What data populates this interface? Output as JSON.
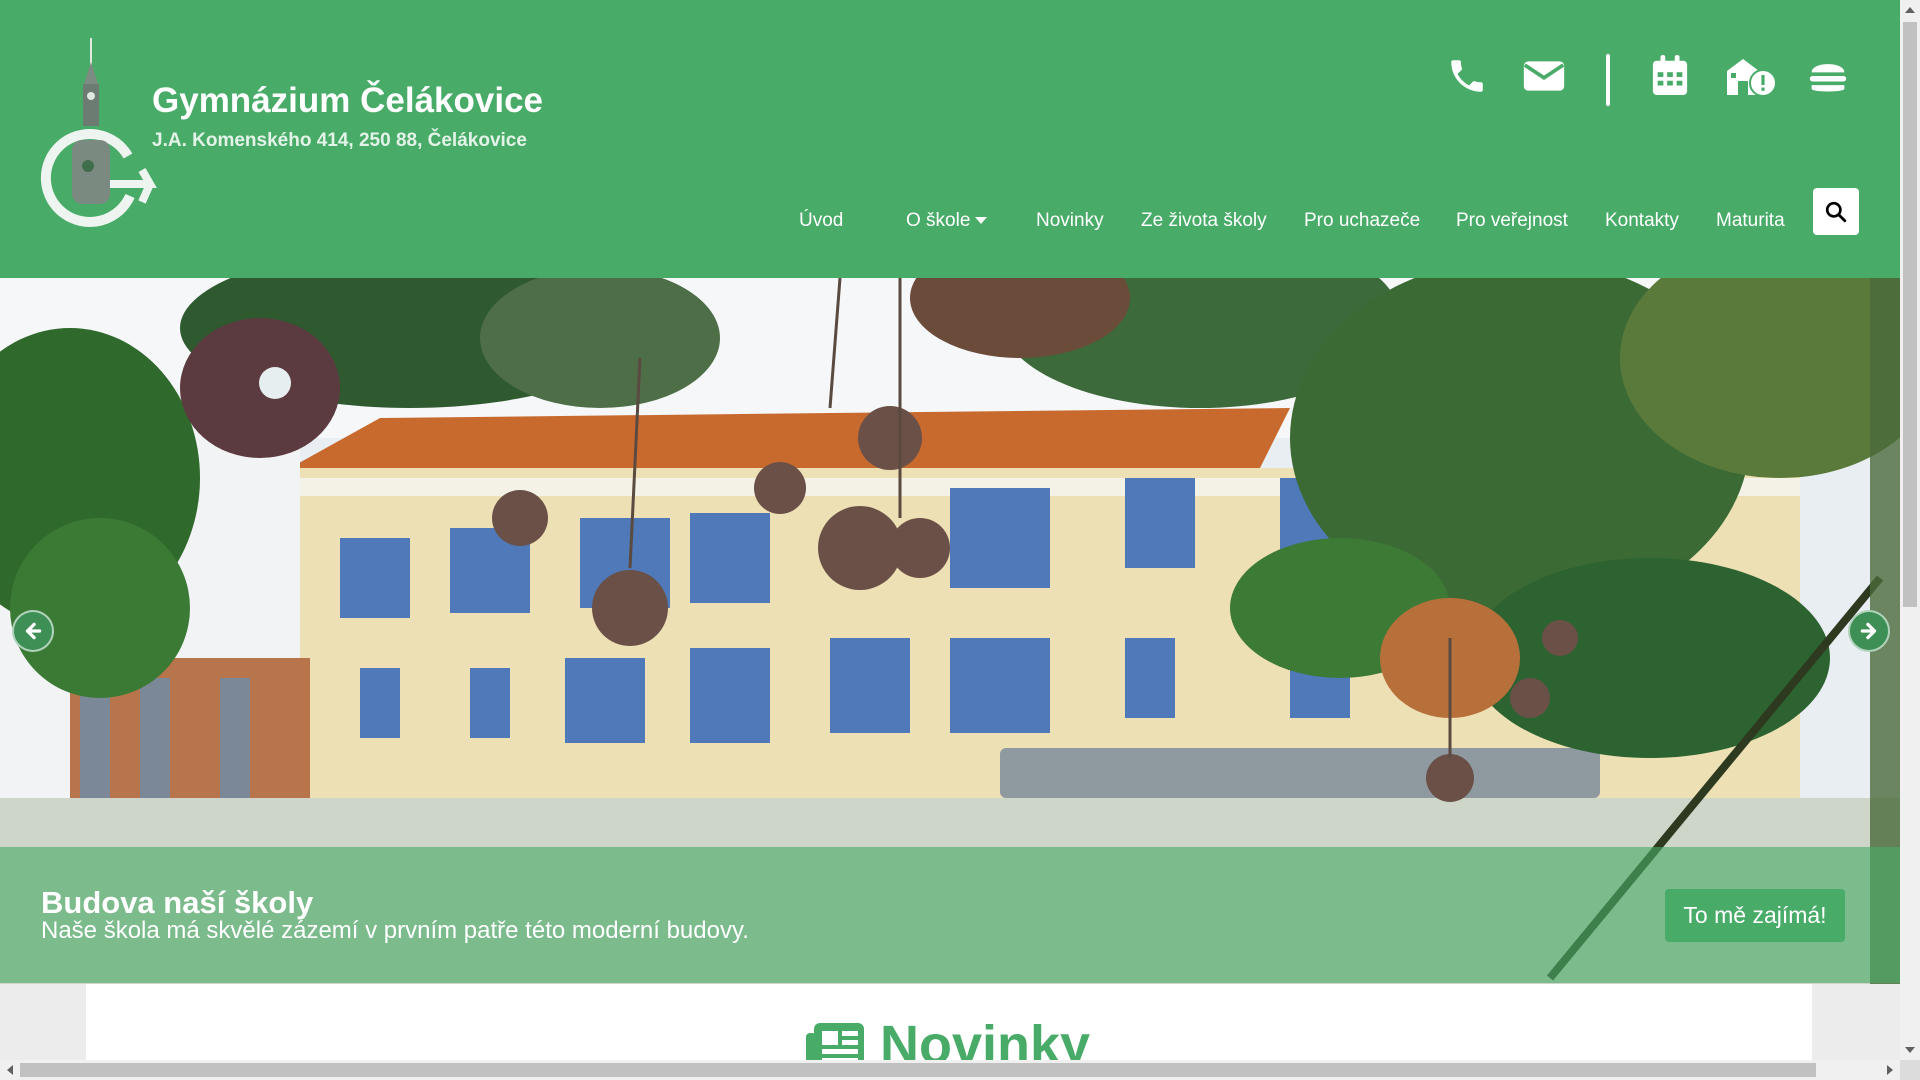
{
  "header": {
    "title": "Gymnázium Čelákovice",
    "address": "J.A. Komenského 414, 250 88, Čelákovice",
    "tools": [
      "phone-icon",
      "envelope-icon",
      "calendar-icon",
      "school-info-icon",
      "burger-icon"
    ],
    "background": "#48ab68"
  },
  "nav": {
    "items": [
      "Úvod",
      "O škole",
      "Novinky",
      "Ze života školy",
      "Pro uchazeče",
      "Pro veřejnost",
      "Kontakty",
      "Maturita"
    ]
  },
  "slider": {
    "caption_title": "Budova naší školy",
    "caption_text": "Naše škola má skvělé zázemí v prvním patře této moderní budovy.",
    "cta_label": "To mě zajímá!"
  },
  "news": {
    "heading": "Novinky"
  }
}
